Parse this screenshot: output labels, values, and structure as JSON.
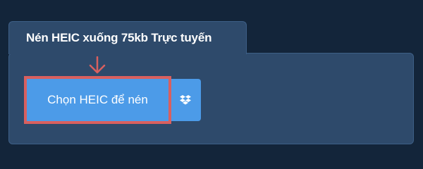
{
  "tab": {
    "title": "Nén HEIC xuống 75kb Trực tuyến"
  },
  "actions": {
    "choose_label": "Chọn HEIC để nén",
    "dropbox_icon": "dropbox-icon"
  },
  "colors": {
    "background": "#13253a",
    "panel": "#2e4a6b",
    "button": "#4c9be8",
    "highlight": "#d9605f"
  }
}
